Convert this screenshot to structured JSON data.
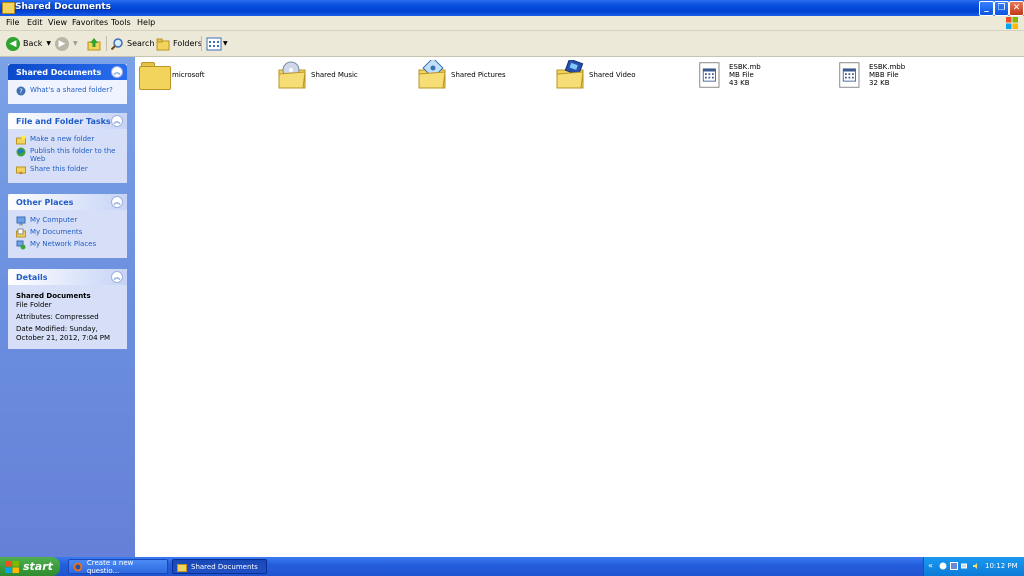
{
  "window": {
    "title": "Shared Documents",
    "buttons": {
      "minimize": "_",
      "maximize": "❐",
      "close": "✕"
    }
  },
  "menu": [
    "File",
    "Edit",
    "View",
    "Favorites",
    "Tools",
    "Help"
  ],
  "toolbar": {
    "back": "Back",
    "search": "Search",
    "folders": "Folders"
  },
  "panels": {
    "shared": {
      "title": "Shared Documents",
      "items": [
        "What's a shared folder?"
      ]
    },
    "tasks": {
      "title": "File and Folder Tasks",
      "items": [
        "Make a new folder",
        "Publish this folder to the Web",
        "Share this folder"
      ]
    },
    "places": {
      "title": "Other Places",
      "items": [
        "My Computer",
        "My Documents",
        "My Network Places"
      ]
    },
    "details": {
      "title": "Details",
      "name": "Shared Documents",
      "type": "File Folder",
      "attributes": "Attributes: Compressed",
      "modified": "Date Modified: Sunday, October 21, 2012, 7:04 PM"
    }
  },
  "files": [
    {
      "name": "microsoft",
      "kind": "folder"
    },
    {
      "name": "Shared Music",
      "kind": "music-folder"
    },
    {
      "name": "Shared Pictures",
      "kind": "pictures-folder"
    },
    {
      "name": "Shared Video",
      "kind": "video-folder"
    },
    {
      "name": "ESBK.mb",
      "type": "MB File",
      "size": "43 KB",
      "kind": "file"
    },
    {
      "name": "ESBK.mbb",
      "type": "MBB File",
      "size": "32 KB",
      "kind": "file"
    }
  ],
  "taskbar": {
    "start": "start",
    "tasks": [
      "Create a new questio...",
      "Shared Documents"
    ],
    "time": "10:12 PM"
  }
}
